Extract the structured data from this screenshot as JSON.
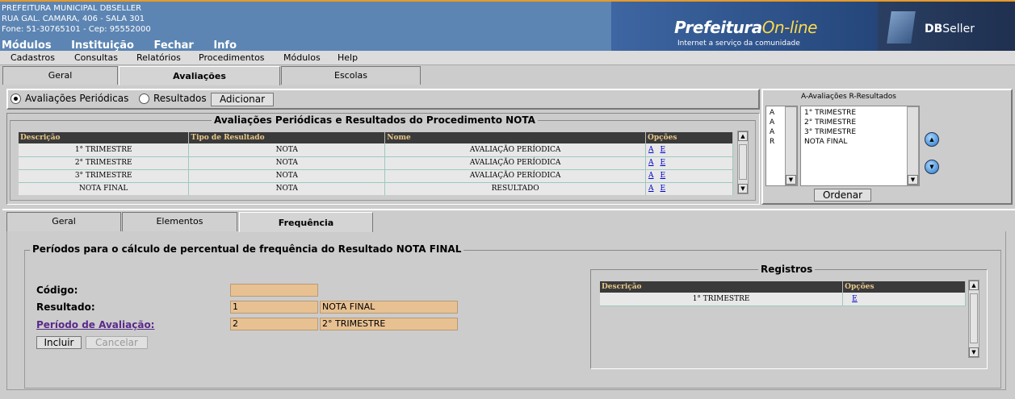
{
  "header": {
    "org_name": "PREFEITURA MUNICIPAL DBSELLER",
    "address": "RUA GAL. CAMARA, 406 - SALA 301",
    "contact": "Fone: 51-30765101  -  Cep: 95552000",
    "menu": [
      "Módulos",
      "Instituição",
      "Fechar",
      "Info"
    ],
    "brand_main": "Prefeitura",
    "brand_online": "On-line",
    "brand_tagline": "Internet a serviço da comunidade",
    "brand2_db": "DB",
    "brand2_seller": "Seller"
  },
  "menubar": [
    "Cadastros",
    "Consultas",
    "Relatórios",
    "Procedimentos",
    "Módulos",
    "Help"
  ],
  "top_tabs": [
    "Geral",
    "Avaliações",
    "Escolas"
  ],
  "radio_bar": {
    "option1": "Avaliações Periódicas",
    "option2": "Resultados",
    "add_button": "Adicionar"
  },
  "procedure_table": {
    "title": "Avaliações Periódicas e Resultados do Procedimento NOTA",
    "headers": [
      "Descrição",
      "Tipo de Resultado",
      "Nome",
      "Opções"
    ],
    "rows": [
      {
        "descricao": "1° TRIMESTRE",
        "tipo": "NOTA",
        "nome": "AVALIAÇÃO PERÍODICA",
        "opt_a": "A",
        "opt_e": "E"
      },
      {
        "descricao": "2° TRIMESTRE",
        "tipo": "NOTA",
        "nome": "AVALIAÇÃO PERÍODICA",
        "opt_a": "A",
        "opt_e": "E"
      },
      {
        "descricao": "3° TRIMESTRE",
        "tipo": "NOTA",
        "nome": "AVALIAÇÃO PERÍODICA",
        "opt_a": "A",
        "opt_e": "E"
      },
      {
        "descricao": "NOTA FINAL",
        "tipo": "NOTA",
        "nome": "RESULTADO",
        "opt_a": "A",
        "opt_e": "E"
      }
    ]
  },
  "ordering_panel": {
    "title": "A-Avaliações R-Resultados",
    "codes": [
      "A",
      "A",
      "A",
      "R"
    ],
    "items": [
      "1° TRIMESTRE",
      "2° TRIMESTRE",
      "3° TRIMESTRE",
      "NOTA FINAL"
    ],
    "order_button": "Ordenar"
  },
  "sub_tabs": [
    "Geral",
    "Elementos",
    "Frequência"
  ],
  "frequency_form": {
    "title": "Períodos para o cálculo de percentual de frequência do Resultado NOTA FINAL",
    "codigo_label": "Código:",
    "codigo_value": "",
    "resultado_label": "Resultado:",
    "resultado_code": "1",
    "resultado_name": "NOTA FINAL",
    "periodo_label": "Período de Avaliação:",
    "periodo_code": "2",
    "periodo_name": "2° TRIMESTRE",
    "incluir_button": "Incluir",
    "cancelar_button": "Cancelar"
  },
  "registros": {
    "title": "Registros",
    "headers": [
      "Descrição",
      "Opções"
    ],
    "rows": [
      {
        "descricao": "1° TRIMESTRE",
        "opt_e": "E"
      }
    ]
  }
}
